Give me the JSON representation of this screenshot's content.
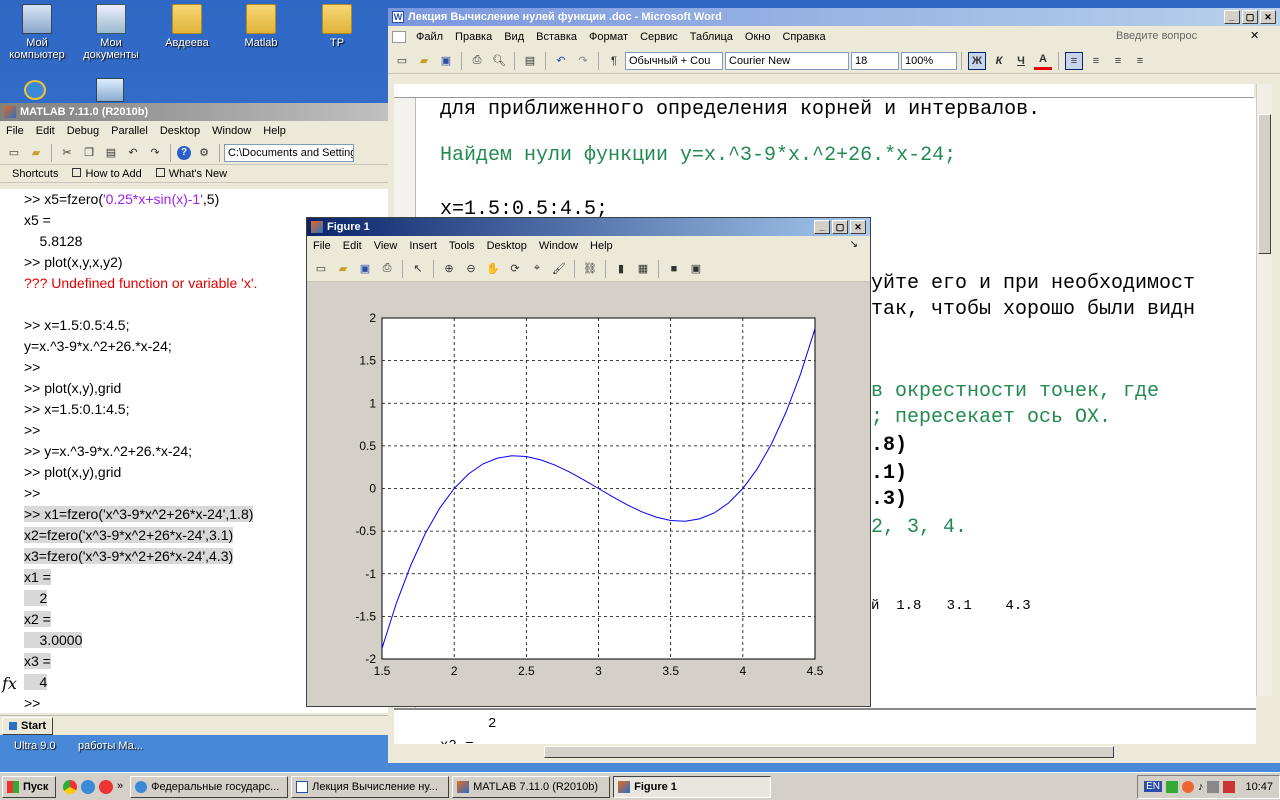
{
  "desktop": {
    "icons": [
      {
        "label": "Мой компьютер"
      },
      {
        "label": "Мои документы"
      },
      {
        "label": "Авдеева"
      },
      {
        "label": "Matlab"
      },
      {
        "label": "ТР"
      }
    ],
    "bottom_icons": [
      {
        "label": "Ultra 9.0"
      },
      {
        "label": "работы Ма..."
      }
    ]
  },
  "matlab": {
    "title": "MATLAB  7.11.0 (R2010b)",
    "menu": [
      "File",
      "Edit",
      "Debug",
      "Parallel",
      "Desktop",
      "Window",
      "Help"
    ],
    "path": "C:\\Documents and Setting",
    "shortcuts": [
      "Shortcuts",
      "How to Add",
      "What's New"
    ],
    "lines": [
      {
        "pre": ">> x5=fzero(",
        "str": "'0.25*x+sin(x)-1'",
        "post": ",5)"
      },
      {
        "text": "x5 ="
      },
      {
        "text": "    5.8128"
      },
      {
        "text": ">> plot(x,y,x,y2)"
      },
      {
        "error": "??? Undefined function or variable 'x'."
      },
      {
        "text": ""
      },
      {
        "text": ">> x=1.5:0.5:4.5;"
      },
      {
        "text": "y=x.^3-9*x.^2+26.*x-24;"
      },
      {
        "text": ">>"
      },
      {
        "text": ">> plot(x,y),grid"
      },
      {
        "text": ">> x=1.5:0.1:4.5;"
      },
      {
        "text": ">>"
      },
      {
        "text": ">> y=x.^3-9*x.^2+26.*x-24;"
      },
      {
        "text": ">> plot(x,y),grid"
      },
      {
        "text": ">>"
      },
      {
        "hl": ">> x1=fzero('x^3-9*x^2+26*x-24',1.8)"
      },
      {
        "hl": "x2=fzero('x^3-9*x^2+26*x-24',3.1)"
      },
      {
        "hl": "x3=fzero('x^3-9*x^2+26*x-24',4.3)"
      },
      {
        "hl": "x1 ="
      },
      {
        "hl": "    2"
      },
      {
        "hl": "x2 ="
      },
      {
        "hl": "    3.0000"
      },
      {
        "hl": "x3 ="
      },
      {
        "hl": "    4"
      }
    ],
    "prompt": ">>",
    "fx": "fx",
    "start": "Start"
  },
  "word": {
    "title": "Лекция Вычисление нулей функции .doc - Microsoft Word",
    "menu": [
      "Файл",
      "Правка",
      "Вид",
      "Вставка",
      "Формат",
      "Сервис",
      "Таблица",
      "Окно",
      "Справка"
    ],
    "question": "Введите вопрос",
    "style": "Обычный + Cou",
    "font": "Courier New",
    "size": "18",
    "zoom": "100%",
    "bold": "Ж",
    "italic": "К",
    "underline": "Ч",
    "line1": "для приближенного определения корней и интервалов.",
    "line2": "Найдем нули функции y=x.^3-9*x.^2+26.*x-24;",
    "line3": "x=1.5:0.5:4.5;",
    "line4": "уйте его и при необходимост",
    "line5": "так, чтобы хорошо были видн",
    "line6": "в окрестности точек, где",
    "line7": "; пересекает ось OX.",
    "line8": ".8)",
    "line9": ".1)",
    "line10": ".3)",
    "line11": "2, 3, 4.",
    "line12": "й  1.8   3.1    4.3",
    "lower1": "2",
    "lower2": "x2 ="
  },
  "figure": {
    "title": "Figure 1",
    "menu": [
      "File",
      "Edit",
      "View",
      "Insert",
      "Tools",
      "Desktop",
      "Window",
      "Help"
    ]
  },
  "chart_data": {
    "type": "line",
    "function": "y=x.^3-9*x.^2+26.*x-24",
    "x": [
      1.5,
      1.6,
      1.7,
      1.8,
      1.9,
      2.0,
      2.1,
      2.2,
      2.3,
      2.4,
      2.5,
      2.6,
      2.7,
      2.8,
      2.9,
      3.0,
      3.1,
      3.2,
      3.3,
      3.4,
      3.5,
      3.6,
      3.7,
      3.8,
      3.9,
      4.0,
      4.1,
      4.2,
      4.3,
      4.4,
      4.5
    ],
    "y": [
      -1.875,
      -1.344,
      -0.897,
      -0.528,
      -0.231,
      0,
      0.171,
      0.288,
      0.357,
      0.384,
      0.375,
      0.336,
      0.273,
      0.192,
      0.099,
      0,
      -0.099,
      -0.192,
      -0.273,
      -0.336,
      -0.375,
      -0.384,
      -0.357,
      -0.288,
      -0.171,
      0,
      0.231,
      0.528,
      0.897,
      1.344,
      1.875
    ],
    "xlim": [
      1.5,
      4.5
    ],
    "ylim": [
      -2,
      2
    ],
    "xticks": [
      "1.5",
      "2",
      "2.5",
      "3",
      "3.5",
      "4",
      "4.5"
    ],
    "yticks": [
      "2",
      "1.5",
      "1",
      "0.5",
      "0",
      "-0.5",
      "-1",
      "-1.5",
      "-2"
    ],
    "grid": true,
    "color": "#0000ff"
  },
  "taskbar": {
    "start": "Пуск",
    "tasks": [
      "Федеральные государс...",
      "Лекция Вычисление ну...",
      "MATLAB  7.11.0 (R2010b)",
      "Figure 1"
    ],
    "lang": "EN",
    "clock": "10:47"
  }
}
